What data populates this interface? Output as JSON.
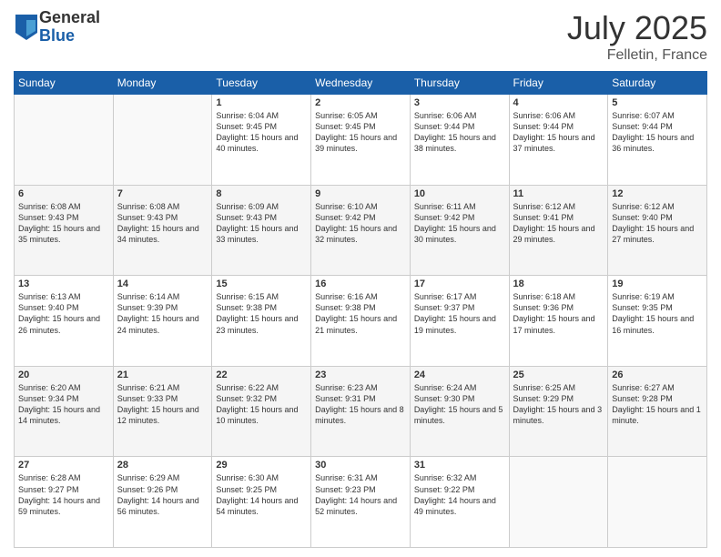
{
  "logo": {
    "general": "General",
    "blue": "Blue"
  },
  "title": {
    "month_year": "July 2025",
    "location": "Felletin, France"
  },
  "days_of_week": [
    "Sunday",
    "Monday",
    "Tuesday",
    "Wednesday",
    "Thursday",
    "Friday",
    "Saturday"
  ],
  "weeks": [
    [
      {
        "day": "",
        "info": ""
      },
      {
        "day": "",
        "info": ""
      },
      {
        "day": "1",
        "info": "Sunrise: 6:04 AM\nSunset: 9:45 PM\nDaylight: 15 hours\nand 40 minutes."
      },
      {
        "day": "2",
        "info": "Sunrise: 6:05 AM\nSunset: 9:45 PM\nDaylight: 15 hours\nand 39 minutes."
      },
      {
        "day": "3",
        "info": "Sunrise: 6:06 AM\nSunset: 9:44 PM\nDaylight: 15 hours\nand 38 minutes."
      },
      {
        "day": "4",
        "info": "Sunrise: 6:06 AM\nSunset: 9:44 PM\nDaylight: 15 hours\nand 37 minutes."
      },
      {
        "day": "5",
        "info": "Sunrise: 6:07 AM\nSunset: 9:44 PM\nDaylight: 15 hours\nand 36 minutes."
      }
    ],
    [
      {
        "day": "6",
        "info": "Sunrise: 6:08 AM\nSunset: 9:43 PM\nDaylight: 15 hours\nand 35 minutes."
      },
      {
        "day": "7",
        "info": "Sunrise: 6:08 AM\nSunset: 9:43 PM\nDaylight: 15 hours\nand 34 minutes."
      },
      {
        "day": "8",
        "info": "Sunrise: 6:09 AM\nSunset: 9:43 PM\nDaylight: 15 hours\nand 33 minutes."
      },
      {
        "day": "9",
        "info": "Sunrise: 6:10 AM\nSunset: 9:42 PM\nDaylight: 15 hours\nand 32 minutes."
      },
      {
        "day": "10",
        "info": "Sunrise: 6:11 AM\nSunset: 9:42 PM\nDaylight: 15 hours\nand 30 minutes."
      },
      {
        "day": "11",
        "info": "Sunrise: 6:12 AM\nSunset: 9:41 PM\nDaylight: 15 hours\nand 29 minutes."
      },
      {
        "day": "12",
        "info": "Sunrise: 6:12 AM\nSunset: 9:40 PM\nDaylight: 15 hours\nand 27 minutes."
      }
    ],
    [
      {
        "day": "13",
        "info": "Sunrise: 6:13 AM\nSunset: 9:40 PM\nDaylight: 15 hours\nand 26 minutes."
      },
      {
        "day": "14",
        "info": "Sunrise: 6:14 AM\nSunset: 9:39 PM\nDaylight: 15 hours\nand 24 minutes."
      },
      {
        "day": "15",
        "info": "Sunrise: 6:15 AM\nSunset: 9:38 PM\nDaylight: 15 hours\nand 23 minutes."
      },
      {
        "day": "16",
        "info": "Sunrise: 6:16 AM\nSunset: 9:38 PM\nDaylight: 15 hours\nand 21 minutes."
      },
      {
        "day": "17",
        "info": "Sunrise: 6:17 AM\nSunset: 9:37 PM\nDaylight: 15 hours\nand 19 minutes."
      },
      {
        "day": "18",
        "info": "Sunrise: 6:18 AM\nSunset: 9:36 PM\nDaylight: 15 hours\nand 17 minutes."
      },
      {
        "day": "19",
        "info": "Sunrise: 6:19 AM\nSunset: 9:35 PM\nDaylight: 15 hours\nand 16 minutes."
      }
    ],
    [
      {
        "day": "20",
        "info": "Sunrise: 6:20 AM\nSunset: 9:34 PM\nDaylight: 15 hours\nand 14 minutes."
      },
      {
        "day": "21",
        "info": "Sunrise: 6:21 AM\nSunset: 9:33 PM\nDaylight: 15 hours\nand 12 minutes."
      },
      {
        "day": "22",
        "info": "Sunrise: 6:22 AM\nSunset: 9:32 PM\nDaylight: 15 hours\nand 10 minutes."
      },
      {
        "day": "23",
        "info": "Sunrise: 6:23 AM\nSunset: 9:31 PM\nDaylight: 15 hours\nand 8 minutes."
      },
      {
        "day": "24",
        "info": "Sunrise: 6:24 AM\nSunset: 9:30 PM\nDaylight: 15 hours\nand 5 minutes."
      },
      {
        "day": "25",
        "info": "Sunrise: 6:25 AM\nSunset: 9:29 PM\nDaylight: 15 hours\nand 3 minutes."
      },
      {
        "day": "26",
        "info": "Sunrise: 6:27 AM\nSunset: 9:28 PM\nDaylight: 15 hours\nand 1 minute."
      }
    ],
    [
      {
        "day": "27",
        "info": "Sunrise: 6:28 AM\nSunset: 9:27 PM\nDaylight: 14 hours\nand 59 minutes."
      },
      {
        "day": "28",
        "info": "Sunrise: 6:29 AM\nSunset: 9:26 PM\nDaylight: 14 hours\nand 56 minutes."
      },
      {
        "day": "29",
        "info": "Sunrise: 6:30 AM\nSunset: 9:25 PM\nDaylight: 14 hours\nand 54 minutes."
      },
      {
        "day": "30",
        "info": "Sunrise: 6:31 AM\nSunset: 9:23 PM\nDaylight: 14 hours\nand 52 minutes."
      },
      {
        "day": "31",
        "info": "Sunrise: 6:32 AM\nSunset: 9:22 PM\nDaylight: 14 hours\nand 49 minutes."
      },
      {
        "day": "",
        "info": ""
      },
      {
        "day": "",
        "info": ""
      }
    ]
  ]
}
